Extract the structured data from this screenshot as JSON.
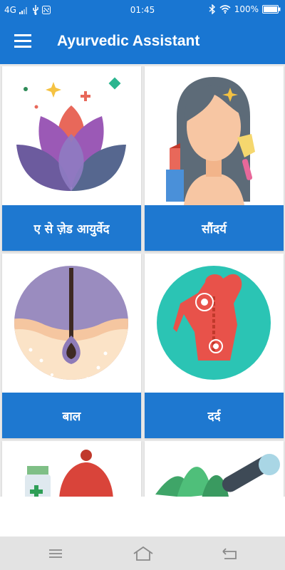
{
  "status_bar": {
    "network": "4G",
    "time": "01:45",
    "battery": "100%",
    "icons": [
      "signal-icon",
      "usb-icon",
      "nfc-icon",
      "bluetooth-icon",
      "wifi-icon",
      "battery-icon"
    ]
  },
  "app_bar": {
    "title": "Ayurvedic Assistant",
    "menu_icon": "hamburger-menu-icon"
  },
  "categories": [
    {
      "label": "ए से ज़ेड आयुर्वेद",
      "icon": "lotus-icon"
    },
    {
      "label": "सौंदर्य",
      "icon": "beauty-woman-icon"
    },
    {
      "label": "बाल",
      "icon": "hair-follicle-icon"
    },
    {
      "label": "दर्द",
      "icon": "back-pain-icon"
    },
    {
      "label": "",
      "icon": "cold-remedy-icon"
    },
    {
      "label": "",
      "icon": "herbal-mortar-icon"
    }
  ],
  "nav_bar": {
    "icons": [
      "menu-lines-icon",
      "home-icon",
      "back-icon"
    ]
  },
  "colors": {
    "primary": "#1976d2",
    "card_label": "#1e78d0",
    "background": "#e9e9e9"
  }
}
